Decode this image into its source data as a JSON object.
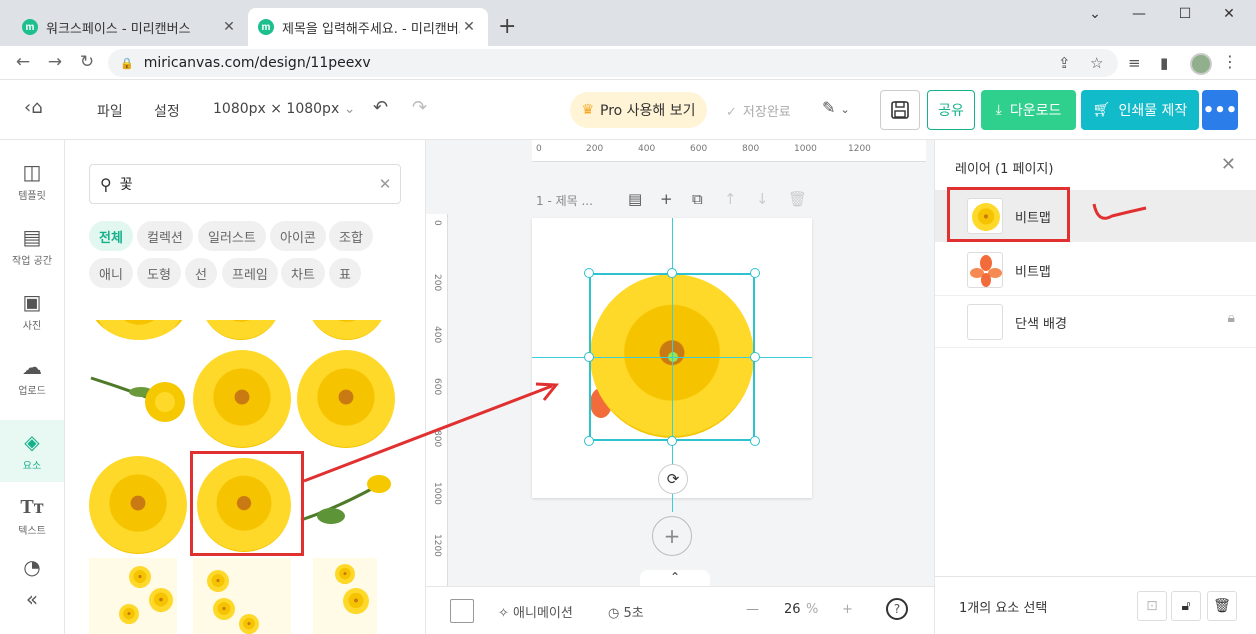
{
  "browser": {
    "tabs": [
      {
        "favicon": "m",
        "title": "워크스페이스 - 미리캔버스"
      },
      {
        "favicon": "m",
        "title": "제목을 입력해주세요. - 미리캔버스"
      }
    ],
    "new_tab": "+",
    "url": "miricanvas.com/design/11peexv"
  },
  "header": {
    "menu_file": "파일",
    "menu_settings": "설정",
    "size": "1080px × 1080px",
    "pro_label": "Pro 사용해 보기",
    "saved_label": "저장완료",
    "share_label": "공유",
    "download_label": "다운로드",
    "print_label": "인쇄물 제작",
    "more_label": "•••"
  },
  "leftnav": [
    {
      "icon": "template-icon",
      "label": "템플릿"
    },
    {
      "icon": "workspace-icon",
      "label": "작업 공간"
    },
    {
      "icon": "photo-icon",
      "label": "사진"
    },
    {
      "icon": "upload-icon",
      "label": "업로드"
    },
    {
      "icon": "elements-icon",
      "label": "요소"
    },
    {
      "icon": "text-icon",
      "label": "텍스트"
    }
  ],
  "search": {
    "query": "꽃",
    "chips": [
      "전체",
      "컬렉션",
      "일러스트",
      "아이콘",
      "조합",
      "애니",
      "도형",
      "선",
      "프레임",
      "차트",
      "표"
    ]
  },
  "canvas": {
    "page_label": "1 - 제목 ...",
    "ruler_h": [
      "0",
      "200",
      "400",
      "600",
      "800",
      "1000",
      "1200"
    ],
    "ruler_v": [
      "0",
      "200",
      "400",
      "600",
      "800",
      "1000",
      "1200"
    ]
  },
  "bottombar": {
    "animation_label": "애니메이션",
    "duration_label": "5초",
    "zoom_value": "26",
    "zoom_unit": "%",
    "help": "?"
  },
  "layers": {
    "title": "레이어 (1 페이지)",
    "items": [
      {
        "name": "비트맵",
        "selected": true
      },
      {
        "name": "비트맵",
        "selected": false
      },
      {
        "name": "단색 배경",
        "selected": false,
        "locked": true
      }
    ],
    "footer_text": "1개의 요소 선택"
  },
  "colors": {
    "brand_green": "#16b08a",
    "download_green": "#2fcf8d",
    "print_teal": "#12bbc9",
    "more_blue": "#2b7de9",
    "selection": "#2ec2cf",
    "annotation_red": "#e03030"
  }
}
